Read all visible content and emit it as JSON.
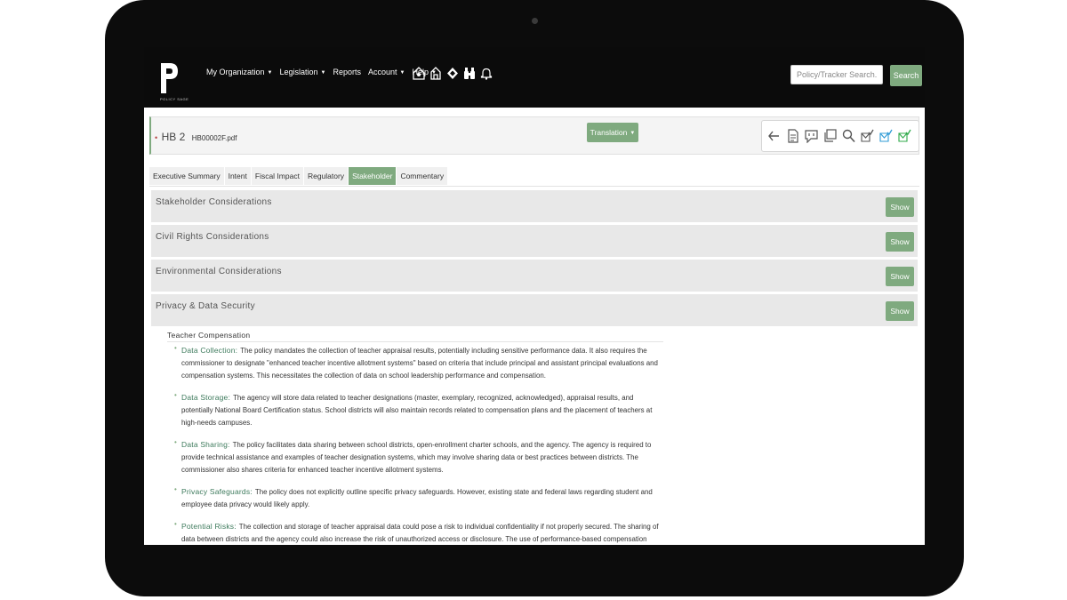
{
  "app": {
    "logo_text": "POLICY SAGE"
  },
  "nav": {
    "items": [
      {
        "label": "My Organization",
        "dropdown": true
      },
      {
        "label": "Legislation",
        "dropdown": true
      },
      {
        "label": "Reports",
        "dropdown": false
      },
      {
        "label": "Account",
        "dropdown": true
      },
      {
        "label": "Help",
        "dropdown": true
      }
    ],
    "icons": [
      "house-icon",
      "building-icon",
      "diamond-grid-icon",
      "binoculars-icon",
      "bell-icon"
    ]
  },
  "search": {
    "placeholder": "Policy/Tracker Search...",
    "button_label": "Search"
  },
  "bill": {
    "number": "HB 2",
    "file": "HB00002F.pdf",
    "translation_label": "Translation",
    "tools": [
      "back-arrow-icon",
      "document-icon",
      "comment-icon",
      "copy-icon",
      "search-icon",
      "mail-check-icon",
      "mail-check-blue-icon",
      "mail-check-green-icon"
    ]
  },
  "tabs": [
    {
      "label": "Executive Summary",
      "active": false
    },
    {
      "label": "Intent",
      "active": false
    },
    {
      "label": "Fiscal Impact",
      "active": false
    },
    {
      "label": "Regulatory",
      "active": false
    },
    {
      "label": "Stakeholder",
      "active": true
    },
    {
      "label": "Commentary",
      "active": false
    }
  ],
  "sections": [
    {
      "title": "Stakeholder Considerations",
      "button": "Show"
    },
    {
      "title": "Civil Rights Considerations",
      "button": "Show"
    },
    {
      "title": "Environmental Considerations",
      "button": "Show"
    },
    {
      "title": "Privacy & Data Security",
      "button": "Show"
    }
  ],
  "content": {
    "topic": "Teacher Compensation",
    "items": [
      {
        "label": "Data Collection:",
        "text": "The policy mandates the collection of teacher appraisal results, potentially including sensitive performance data. It also requires the commissioner to designate \"enhanced teacher incentive allotment systems\" based on criteria that include principal and assistant principal evaluations and compensation systems. This necessitates the collection of data on school leadership performance and compensation."
      },
      {
        "label": "Data Storage:",
        "text": "The agency will store data related to teacher designations (master, exemplary, recognized, acknowledged), appraisal results, and potentially National Board Certification status. School districts will also maintain records related to compensation plans and the placement of teachers at high-needs campuses."
      },
      {
        "label": "Data Sharing:",
        "text": "The policy facilitates data sharing between school districts, open-enrollment charter schools, and the agency. The agency is required to provide technical assistance and examples of teacher designation systems, which may involve sharing data or best practices between districts. The commissioner also shares criteria for enhanced teacher incentive allotment systems."
      },
      {
        "label": "Privacy Safeguards:",
        "text": "The policy does not explicitly outline specific privacy safeguards. However, existing state and federal laws regarding student and employee data privacy would likely apply."
      },
      {
        "label": "Potential Risks:",
        "text": "The collection and storage of teacher appraisal data could pose a risk to individual confidentiality if not properly secured. The sharing of data between districts and the agency could also increase the risk of unauthorized access or disclosure. The use of performance-based compensation systems could create incentives for data manipulation or bias in evaluations."
      }
    ]
  },
  "colors": {
    "accent": "#7faa7f",
    "label": "#3d7a5c",
    "topbar": "#0b0b0b",
    "section_bg": "#e8e8e8"
  }
}
